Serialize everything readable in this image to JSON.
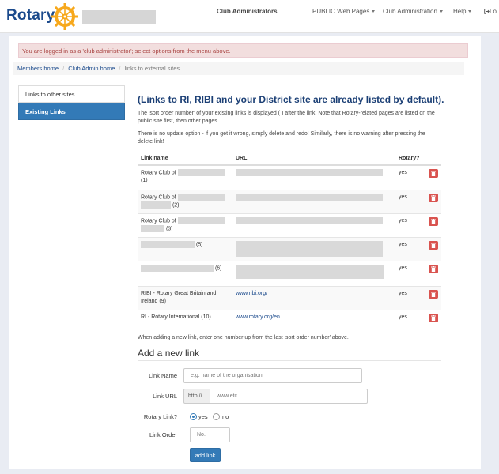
{
  "header": {
    "logo_text": "Rotary",
    "nav": {
      "club_admins": "Club Administrators",
      "public_pages": "PUBLIC Web Pages",
      "club_admin": "Club Administration",
      "help": "Help",
      "logout": "Lo"
    }
  },
  "alert": "You are logged in as a 'club administrator'; select options from the menu above.",
  "breadcrumb": [
    "Members home",
    "Club Admin home",
    "links to external sites"
  ],
  "sidebar": {
    "items": [
      {
        "label": "Links to other sites",
        "active": false
      },
      {
        "label": "Existing Links",
        "active": true
      }
    ]
  },
  "content": {
    "heading": "(Links to RI, RIBI and your District site are already listed by default).",
    "para1": "The 'sort order number' of your existing links is displayed ( ) after the link. Note that Rotary-related pages are listed on the public site first, then other pages.",
    "para2": "There is no update option - if you get it wrong, simply delete and redo! Similarly, there is no warning after pressing the delete link!"
  },
  "table": {
    "headers": [
      "Link name",
      "URL",
      "Rotary?"
    ],
    "rows": [
      {
        "name": "Rotary Club of",
        "order": "(1)",
        "url": "",
        "rotary": "yes"
      },
      {
        "name": "Rotary Club of",
        "order": "(2)",
        "url": "",
        "rotary": "yes"
      },
      {
        "name": "Rotary Club of",
        "order": "(3)",
        "url": "",
        "rotary": "yes"
      },
      {
        "name": "",
        "order": "(5)",
        "url": "",
        "rotary": "yes"
      },
      {
        "name": "",
        "order": "(6)",
        "url": "",
        "rotary": "yes"
      },
      {
        "name": "RIBI - Rotary Great Britain and Ireland",
        "order": "(9)",
        "url": "www.ribi.org/",
        "rotary": "yes"
      },
      {
        "name": "RI - Rotary International",
        "order": "(10)",
        "url": "www.rotary.org/en",
        "rotary": "yes"
      }
    ]
  },
  "note": "When adding a new link, enter one number up from the last 'sort order number' above.",
  "form": {
    "heading": "Add a new link",
    "link_name_label": "Link Name",
    "link_name_placeholder": "e.g. name of the organisation",
    "link_url_label": "Link URL",
    "link_url_prefix": "http://",
    "link_url_placeholder": "www.etc",
    "rotary_label": "Rotary Link?",
    "rotary_yes": "yes",
    "rotary_no": "no",
    "order_label": "Link Order",
    "order_placeholder": "No.",
    "submit_label": "add link"
  },
  "colors": {
    "brand_blue": "#1b4a8c",
    "primary": "#337ab7",
    "danger": "#d9534f",
    "alert_bg": "#f2dede",
    "rotary_gold": "#f7a81b"
  }
}
